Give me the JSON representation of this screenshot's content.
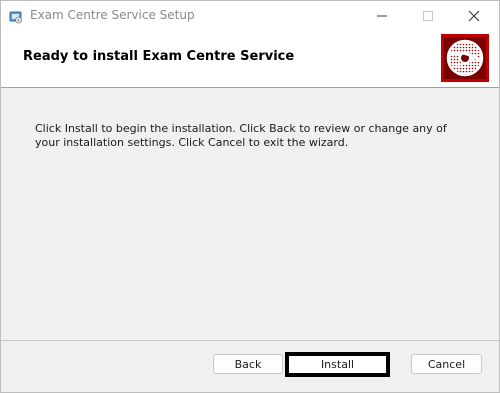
{
  "window": {
    "title": "Exam Centre Service Setup"
  },
  "header": {
    "title": "Ready to install Exam Centre Service",
    "logo_icon": "cd-disc-icon",
    "logo_color": "#c00000"
  },
  "body": {
    "instructions": "Click Install to begin the installation. Click Back to review or change any of your installation settings. Click Cancel to exit the wizard."
  },
  "buttons": {
    "back": "Back",
    "install": "Install",
    "cancel": "Cancel"
  },
  "icons": {
    "app": "installer-icon",
    "minimize": "minimize-icon",
    "maximize": "maximize-icon",
    "close": "close-icon"
  }
}
